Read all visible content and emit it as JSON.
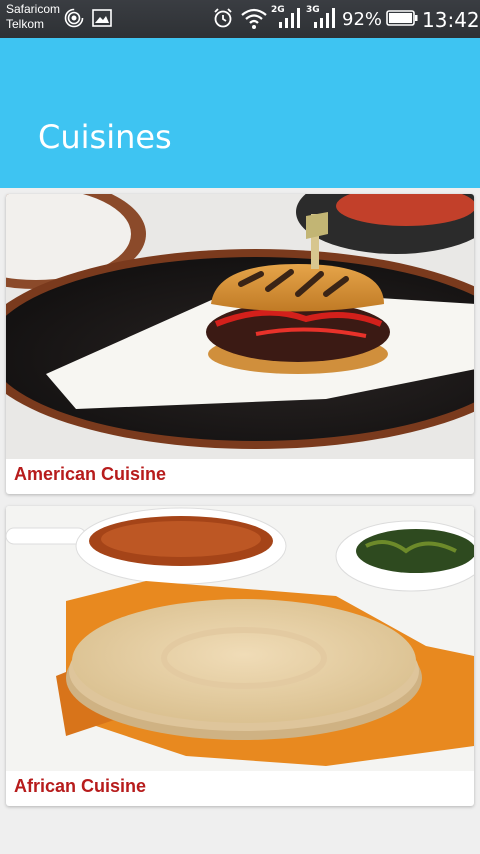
{
  "status_bar": {
    "carrier_1": "Safaricom",
    "carrier_2": "Telkom",
    "net_1": "2G",
    "net_2": "3G",
    "battery": "92%",
    "time": "13:42"
  },
  "app_bar": {
    "title": "Cuisines",
    "color": "#3ec4f2"
  },
  "cuisines": [
    {
      "label": "American Cuisine",
      "image": "burger-photo"
    },
    {
      "label": "African Cuisine",
      "image": "injera-beans-photo"
    }
  ],
  "colors": {
    "label": "#b71c1c",
    "background": "#efefef"
  }
}
